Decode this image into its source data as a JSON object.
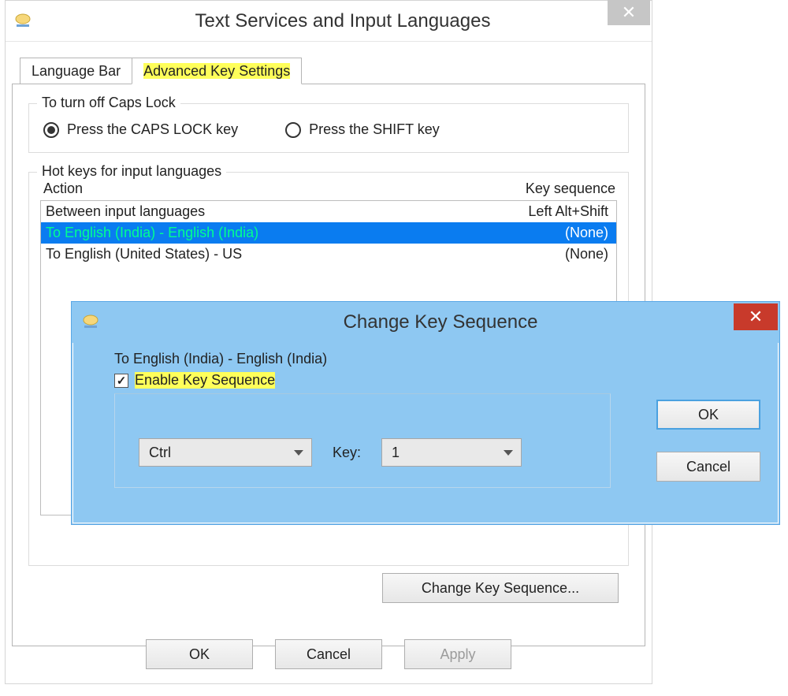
{
  "window": {
    "title": "Text Services and Input Languages",
    "tabs": {
      "language_bar": "Language Bar",
      "advanced_key": "Advanced Key Settings"
    },
    "caps": {
      "legend": "To turn off Caps Lock",
      "opt_capslock": "Press the CAPS LOCK key",
      "opt_shift": "Press the SHIFT key"
    },
    "hotkeys": {
      "legend": "Hot keys for input languages",
      "col_action": "Action",
      "col_keyseq": "Key sequence",
      "rows": [
        {
          "action": "Between input languages",
          "keyseq": "Left Alt+Shift"
        },
        {
          "action": "To English (India) - English (India)",
          "keyseq": "(None)"
        },
        {
          "action": "To English (United States) - US",
          "keyseq": "(None)"
        }
      ],
      "change_btn": "Change Key Sequence..."
    },
    "buttons": {
      "ok": "OK",
      "cancel": "Cancel",
      "apply": "Apply"
    }
  },
  "modal": {
    "title": "Change Key Sequence",
    "desc": "To English (India) - English (India)",
    "enable_label": "Enable Key Sequence",
    "modifier_value": "Ctrl",
    "key_label": "Key:",
    "key_value": "1",
    "ok": "OK",
    "cancel": "Cancel"
  }
}
